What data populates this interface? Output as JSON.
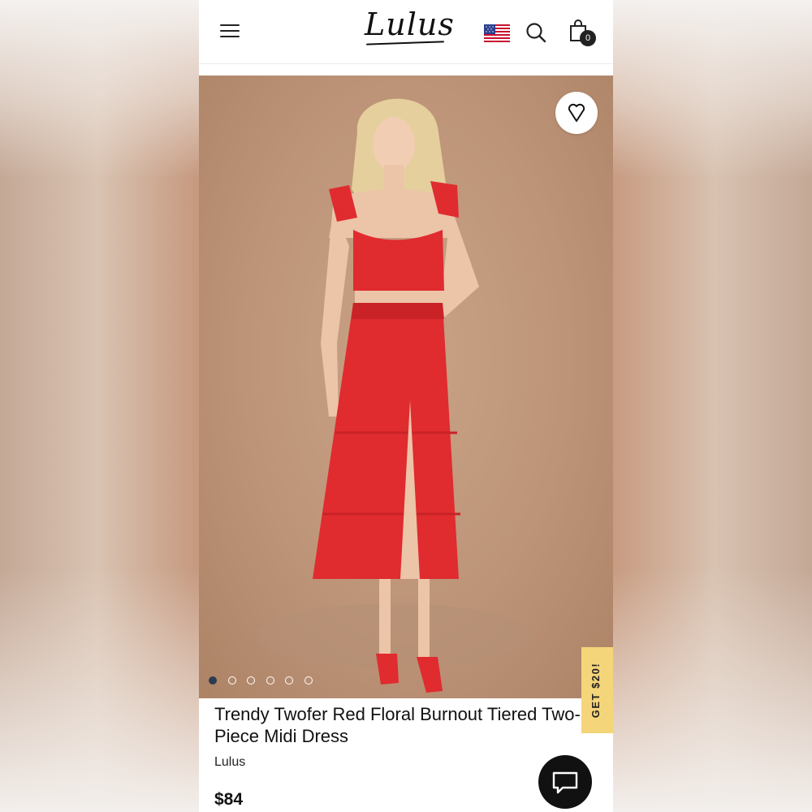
{
  "header": {
    "logo_text": "Lulus",
    "menu_icon": "hamburger-menu-icon",
    "flag_icon": "us-flag-icon",
    "search_icon": "search-icon",
    "bag_icon": "shopping-bag-icon",
    "bag_count": "0"
  },
  "product": {
    "image_description_icon": "product-photo",
    "favorite_icon": "heart-icon",
    "gallery": {
      "count": 6,
      "active_index": 0
    },
    "title": "Trendy Twofer Red Floral Burnout Tiered Two-Piece Midi Dress",
    "brand": "Lulus",
    "price": "$84"
  },
  "promo": {
    "label": "GET $20!"
  },
  "chat": {
    "icon": "chat-icon"
  },
  "colors": {
    "dress_red": "#e02b2f",
    "promo_yellow": "#f5d57a",
    "active_dot": "#2c3b52",
    "text": "#111111"
  }
}
